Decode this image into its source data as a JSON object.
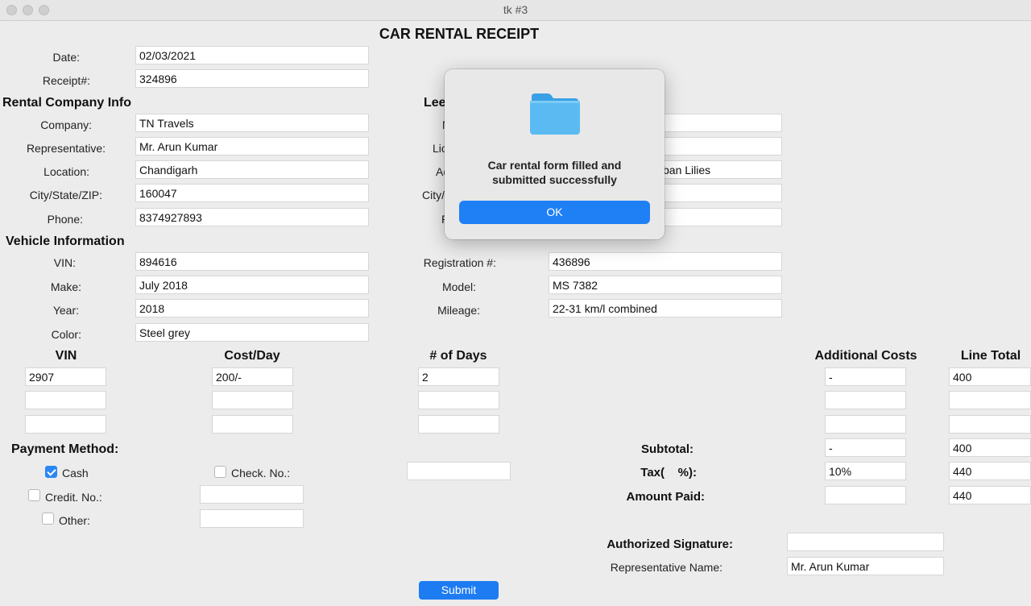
{
  "window": {
    "title": "tk #3"
  },
  "form_title": "CAR RENTAL RECEIPT",
  "top": {
    "date_label": "Date:",
    "date_value": "02/03/2021",
    "receipt_label": "Receipt#:",
    "receipt_value": "324896"
  },
  "company": {
    "header": "Rental Company Info",
    "company_label": "Company:",
    "company_value": "TN Travels",
    "rep_label": "Representative:",
    "rep_value": "Mr. Arun Kumar",
    "location_label": "Location:",
    "location_value": "Chandigarh",
    "city_label": "City/State/ZIP:",
    "city_value": "160047",
    "phone_label": "Phone:",
    "phone_value": "8374927893"
  },
  "lessee": {
    "header_partial": "Lee",
    "label1_partial": "N",
    "label2_partial": "Lic",
    "label3_partial": "Ac",
    "label4_partial": "City/",
    "label5_partial": "P",
    "address_partial": "ban Lilies"
  },
  "vehicle": {
    "header": "Vehicle Information",
    "vin_label": "VIN:",
    "vin_value": "894616",
    "make_label": "Make:",
    "make_value": "July 2018",
    "year_label": "Year:",
    "year_value": "2018",
    "color_label": "Color:",
    "color_value": "Steel grey",
    "reg_label": "Registration #:",
    "reg_value": "436896",
    "model_label": "Model:",
    "model_value": "MS 7382",
    "mileage_label": "Mileage:",
    "mileage_value": "22-31 km/l combined"
  },
  "costs": {
    "headers": {
      "vin": "VIN",
      "cost_day": "Cost/Day",
      "days": "# of Days",
      "additional": "Additional Costs",
      "line_total": "Line Total"
    },
    "rows": [
      {
        "vin": "2907",
        "cost_day": "200/-",
        "days": "2",
        "additional": "-",
        "line_total": "400"
      },
      {
        "vin": "",
        "cost_day": "",
        "days": "",
        "additional": "",
        "line_total": ""
      },
      {
        "vin": "",
        "cost_day": "",
        "days": "",
        "additional": "",
        "line_total": ""
      }
    ]
  },
  "payment": {
    "header": "Payment Method:",
    "cash_label": "Cash",
    "cash_checked": true,
    "check_label": "Check. No.:",
    "check_checked": false,
    "check_value": "",
    "credit_label": "Credit. No.:",
    "credit_checked": false,
    "credit_value": "",
    "other_label": "Other:",
    "other_checked": false,
    "other_value": ""
  },
  "totals": {
    "subtotal_label": "Subtotal:",
    "subtotal_mid": "-",
    "subtotal_value": "400",
    "tax_label": "Tax(    %):",
    "tax_mid": "10%",
    "tax_value": "440",
    "paid_label": "Amount Paid:",
    "paid_mid": "",
    "paid_value": "440"
  },
  "signature": {
    "auth_label": "Authorized Signature:",
    "auth_value": "",
    "rep_name_label": "Representative Name:",
    "rep_name_value": "Mr. Arun Kumar"
  },
  "submit_label": "Submit",
  "dialog": {
    "icon": "folder-icon",
    "message": "Car rental form filled and submitted successfully",
    "ok_label": "OK",
    "accent": "#1f80f5"
  }
}
